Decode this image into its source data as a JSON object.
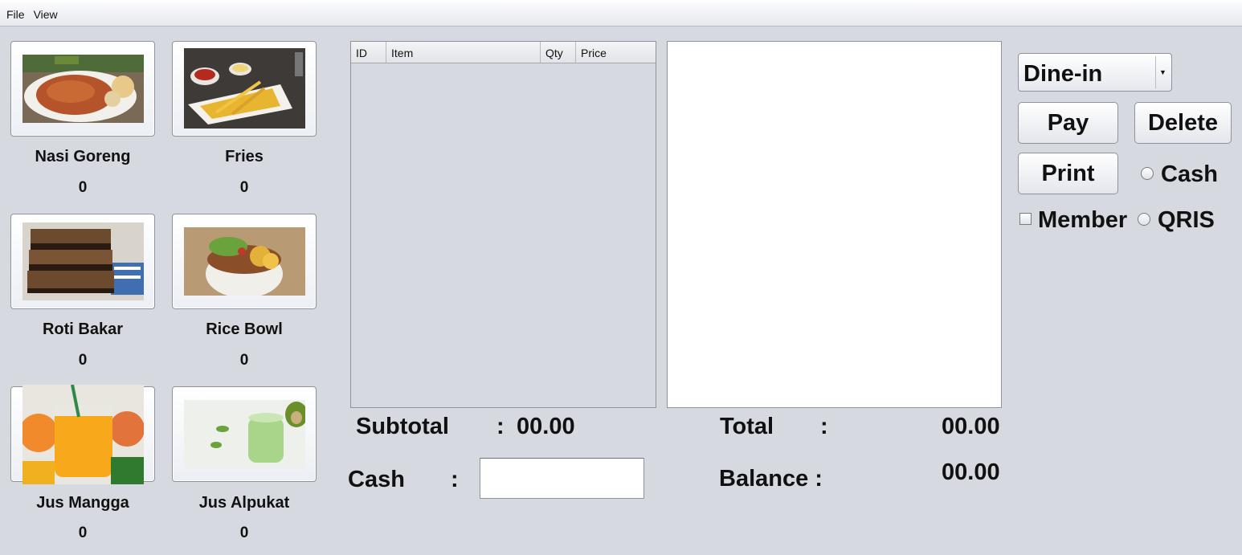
{
  "menubar": {
    "items": [
      "File",
      "View"
    ]
  },
  "menu_items": [
    {
      "name": "Nasi Goreng",
      "count": "0"
    },
    {
      "name": "Fries",
      "count": "0"
    },
    {
      "name": "Roti Bakar",
      "count": "0"
    },
    {
      "name": "Rice Bowl",
      "count": "0"
    },
    {
      "name": "Jus Mangga",
      "count": "0"
    },
    {
      "name": "Jus Alpukat",
      "count": "0"
    }
  ],
  "order_table": {
    "columns": [
      "ID",
      "Item",
      "Qty",
      "Price"
    ],
    "rows": []
  },
  "summary": {
    "subtotal_label": "Subtotal",
    "subtotal_colon": ":",
    "subtotal_value": "00.00",
    "cash_label": "Cash",
    "cash_colon": ":",
    "cash_value": "",
    "total_label": "Total",
    "total_colon": ":",
    "total_value": "00.00",
    "balance_label": "Balance :",
    "balance_value": "00.00"
  },
  "controls": {
    "order_type": "Dine-in",
    "pay_label": "Pay",
    "delete_label": "Delete",
    "print_label": "Print",
    "cash_option": "Cash",
    "qris_option": "QRIS",
    "member_label": "Member"
  }
}
